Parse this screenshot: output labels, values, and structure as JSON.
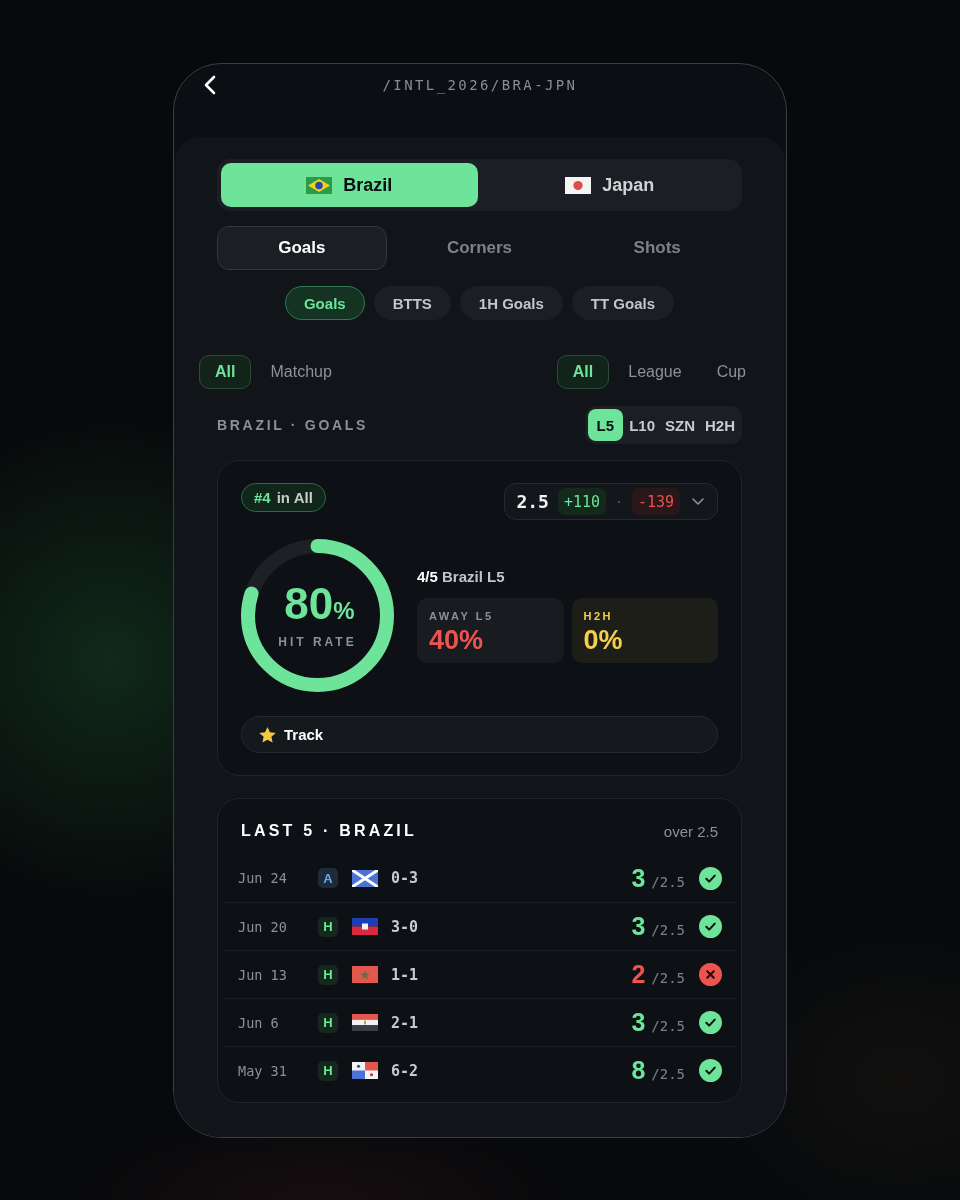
{
  "header": {
    "path": "/INTL_2026/BRA-JPN"
  },
  "teams": [
    {
      "name": "Brazil",
      "flag": {
        "kind": "brazil"
      },
      "selected": true
    },
    {
      "name": "Japan",
      "flag": {
        "kind": "japan"
      },
      "selected": false
    }
  ],
  "stat_tabs": [
    {
      "label": "Goals",
      "selected": true
    },
    {
      "label": "Corners",
      "selected": false
    },
    {
      "label": "Shots",
      "selected": false
    }
  ],
  "markets": [
    {
      "label": "Goals",
      "selected": true
    },
    {
      "label": "BTTS",
      "selected": false
    },
    {
      "label": "1H Goals",
      "selected": false
    },
    {
      "label": "TT Goals",
      "selected": false
    }
  ],
  "scope_filters": [
    {
      "label": "All",
      "selected": true
    },
    {
      "label": "Matchup",
      "selected": false
    }
  ],
  "competition_filters": [
    {
      "label": "All",
      "selected": true
    },
    {
      "label": "League",
      "selected": false
    },
    {
      "label": "Cup",
      "selected": false
    }
  ],
  "section": {
    "title": "BRAZIL · GOALS",
    "periods": [
      {
        "label": "L5",
        "selected": true
      },
      {
        "label": "L10",
        "selected": false
      },
      {
        "label": "SZN",
        "selected": false
      },
      {
        "label": "H2H",
        "selected": false
      }
    ]
  },
  "summary": {
    "rank": "#4",
    "rank_scope": "in All",
    "line": "2.5",
    "over_odds": "+110",
    "separator": "·",
    "under_odds": "-139",
    "hit_rate": "80",
    "hit_rate_unit": "%",
    "hit_rate_label": "HIT RATE",
    "level": 0.8,
    "record": "**4/5** Brazil L5",
    "stats": [
      {
        "label": "AWAY L5",
        "value": "40%",
        "color": "#ef5350",
        "highlighted": false
      },
      {
        "label": "H2H",
        "value": "0%",
        "color": "#f5cf4a",
        "highlighted": true
      }
    ],
    "track_label": "Track"
  },
  "last_five": {
    "title": "LAST 5 · BRAZIL",
    "line_caption": "over 2.5",
    "matches": [
      {
        "date": "Jun 24",
        "venue": {
          "label": "A",
          "kind": "away"
        },
        "flag": {
          "kind": "scotland"
        },
        "score": "0-3",
        "total": "3",
        "line": "/2.5",
        "hit": true
      },
      {
        "date": "Jun 20",
        "venue": {
          "label": "H",
          "kind": "home"
        },
        "flag": {
          "kind": "haiti"
        },
        "score": "3-0",
        "total": "3",
        "line": "/2.5",
        "hit": true
      },
      {
        "date": "Jun 13",
        "venue": {
          "label": "H",
          "kind": "home"
        },
        "flag": {
          "kind": "morocco"
        },
        "score": "1-1",
        "total": "2",
        "line": "/2.5",
        "hit": false
      },
      {
        "date": "Jun 6",
        "venue": {
          "label": "H",
          "kind": "home"
        },
        "flag": {
          "kind": "egypt"
        },
        "score": "2-1",
        "total": "3",
        "line": "/2.5",
        "hit": true
      },
      {
        "date": "May 31",
        "venue": {
          "label": "H",
          "kind": "home"
        },
        "flag": {
          "kind": "panama"
        },
        "score": "6-2",
        "total": "8",
        "line": "/2.5",
        "hit": true
      }
    ]
  }
}
